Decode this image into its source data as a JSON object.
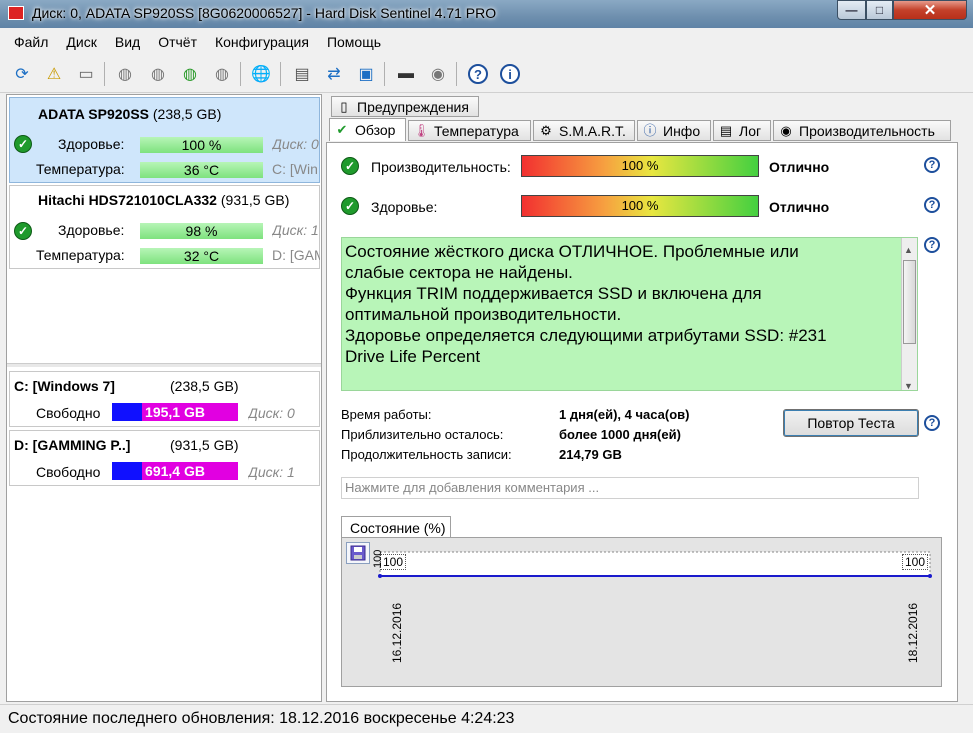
{
  "window": {
    "title": "Диск: 0, ADATA SP920SS [8G0620006527]  -  Hard Disk Sentinel 4.71 PRO",
    "min": "—",
    "max": "□",
    "close": "✕"
  },
  "menu": [
    "Файл",
    "Диск",
    "Вид",
    "Отчёт",
    "Конфигурация",
    "Помощь"
  ],
  "disks": [
    {
      "name": "ADATA SP920SS",
      "size": "(238,5 GB)",
      "health_label": "Здоровье:",
      "health_value": "100 %",
      "health_pct": 100,
      "health_right": "Диск: 0",
      "temp_label": "Температура:",
      "temp_value": "36 °C",
      "temp_right": "C: [Win"
    },
    {
      "name": "Hitachi HDS721010CLA332",
      "size": "(931,5 GB)",
      "health_label": "Здоровье:",
      "health_value": "98 %",
      "health_pct": 98,
      "health_right": "Диск: 1",
      "temp_label": "Температура:",
      "temp_value": "32 °C",
      "temp_right": "D: [GAM"
    }
  ],
  "volumes": [
    {
      "name": "C: [Windows 7]",
      "size": "(238,5 GB)",
      "free_label": "Свободно",
      "free_value": "195,1 GB",
      "disk": "Диск: 0"
    },
    {
      "name": "D: [GAMMING P..]",
      "size": "(931,5 GB)",
      "free_label": "Свободно",
      "free_value": "691,4 GB",
      "disk": "Диск: 1"
    }
  ],
  "tabs": {
    "warnings": "Предупреждения",
    "overview": "Обзор",
    "temperature": "Температура",
    "smart": "S.M.A.R.T.",
    "info": "Инфо",
    "log": "Лог",
    "performance": "Производительность"
  },
  "overview": {
    "perf_label": "Производительность:",
    "perf_value": "100 %",
    "perf_status": "Отлично",
    "health_label": "Здоровье:",
    "health_value": "100 %",
    "health_status": "Отлично",
    "message": [
      "Состояние жёсткого диска ОТЛИЧНОЕ. Проблемные или",
      "слабые сектора не найдены.",
      "Функция TRIM поддерживается SSD и включена для",
      "оптимальной производительности.",
      "Здоровье определяется следующими атрибутами SSD: #231",
      "Drive Life Percent"
    ],
    "uptime_label": "Время работы:",
    "uptime_value": "1 дня(ей), 4 часа(ов)",
    "remaining_label": "Приблизительно осталось:",
    "remaining_value": "более 1000 дня(ей)",
    "writes_label": "Продолжительность записи:",
    "writes_value": "214,79 GB",
    "retest_button": "Повтор Теста",
    "comment_placeholder": "Нажмите для добавления комментария ..."
  },
  "history": {
    "tab": "Состояние (%)",
    "value_left": "100",
    "value_right": "100",
    "ylabel": "100",
    "date_left": "16.12.2016",
    "date_right": "18.12.2016"
  },
  "status": "Состояние последнего обновления: 18.12.2016 воскресенье 4:24:23"
}
